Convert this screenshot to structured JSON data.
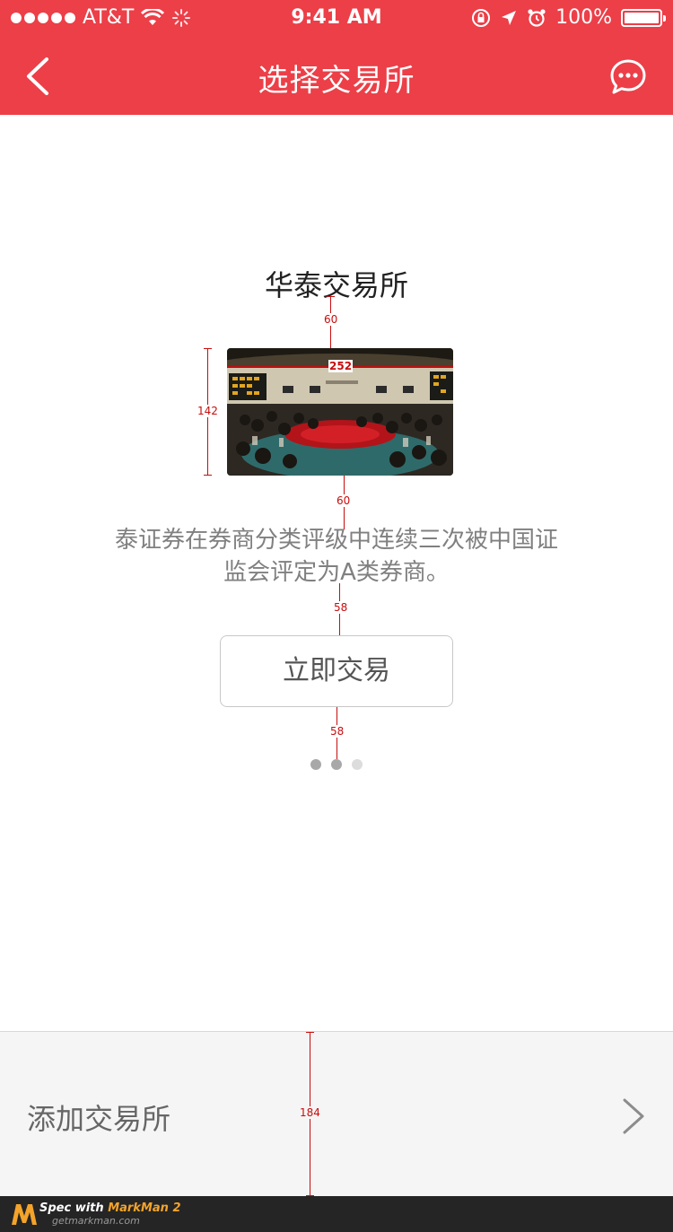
{
  "status_bar": {
    "carrier": "AT&T",
    "time": "9:41 AM",
    "battery": "100%"
  },
  "nav": {
    "title": "选择交易所",
    "back_icon": "chevron-left-icon",
    "chat_icon": "chat-bubble-icon"
  },
  "exchange": {
    "name": "华泰交易所",
    "description": "泰证券在券商分类评级中连续三次被中国证监会评定为A类券商。",
    "trade_button": "立即交易"
  },
  "pager": {
    "total": 3,
    "active": 2
  },
  "spec_labels": {
    "title_to_image": "60",
    "image_width": "252",
    "image_height": "142",
    "image_to_text": "60",
    "text_to_button": "58",
    "button_to_pager": "58",
    "bottom_bar_height": "184"
  },
  "bottom_bar": {
    "label": "添加交易所",
    "chevron_icon": "chevron-right-icon"
  },
  "footer": {
    "prefix": "Spec with ",
    "brand": "MarkMan 2",
    "url": "getmarkman.com"
  },
  "colors": {
    "accent": "#ec3f48",
    "spec_red": "#c70d0d",
    "bottom_bar_bg": "#f5f5f5"
  }
}
